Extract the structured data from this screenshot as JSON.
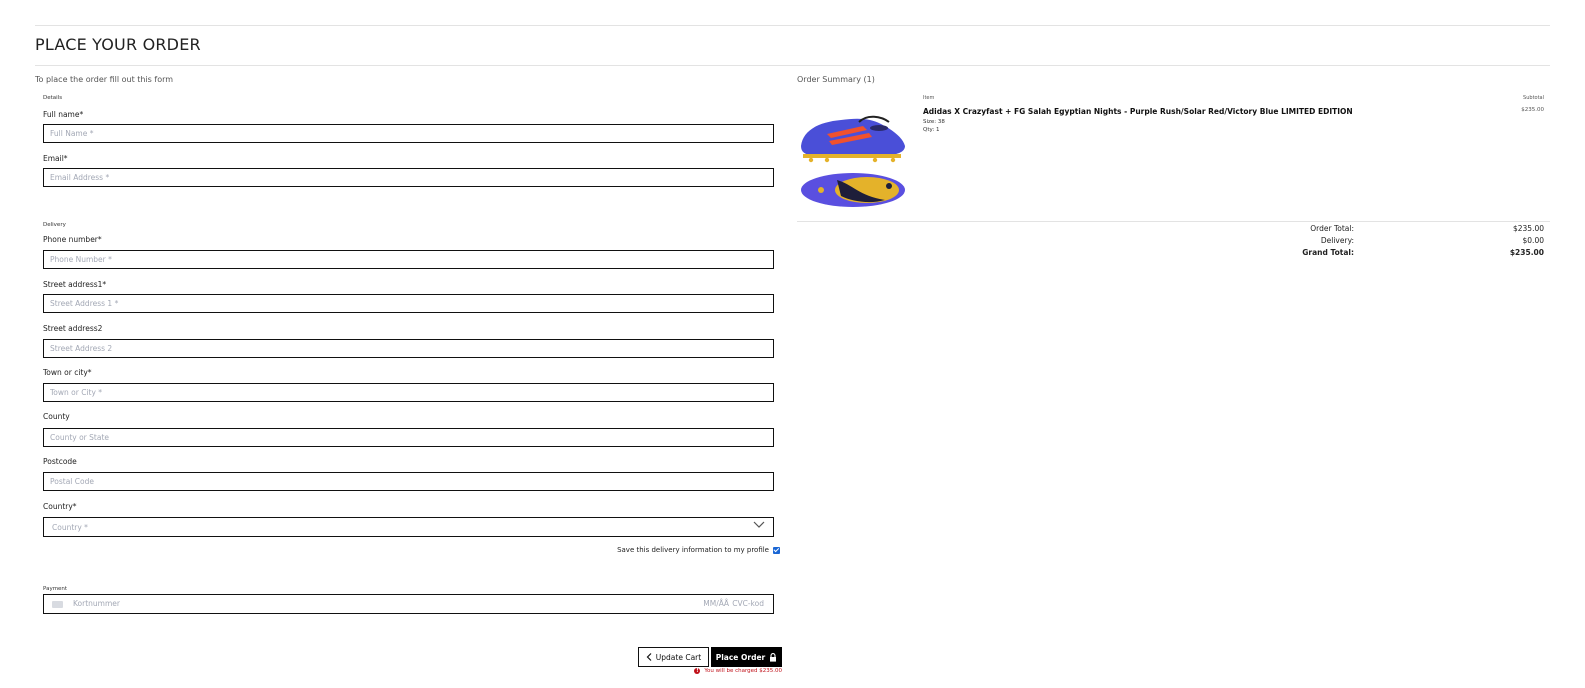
{
  "page": {
    "title": "PLACE YOUR ORDER",
    "intro": "To place the order fill out this form"
  },
  "form": {
    "details_legend": "Details",
    "full_name": {
      "label": "Full name*",
      "placeholder": "Full Name *"
    },
    "email": {
      "label": "Email*",
      "placeholder": "Email Address *"
    },
    "delivery_legend": "Delivery",
    "phone": {
      "label": "Phone number*",
      "placeholder": "Phone Number *"
    },
    "street1": {
      "label": "Street address1*",
      "placeholder": "Street Address 1 *"
    },
    "street2": {
      "label": "Street address2",
      "placeholder": "Street Address 2"
    },
    "town": {
      "label": "Town or city*",
      "placeholder": "Town or City *"
    },
    "county": {
      "label": "County",
      "placeholder": "County or State"
    },
    "postcode": {
      "label": "Postcode",
      "placeholder": "Postal Code"
    },
    "country": {
      "label": "Country*",
      "placeholder": "Country *"
    },
    "save_info": "Save this delivery information to my profile",
    "save_info_checked": true,
    "payment_legend": "Payment",
    "card": {
      "number_placeholder": "Kortnummer",
      "expiry_placeholder": "MM/ÅÅ",
      "cvc_placeholder": "CVC-kod",
      "icon": "credit-card-icon"
    }
  },
  "actions": {
    "update_cart": "Update Cart",
    "place_order": "Place Order",
    "charge_notice": "You will be charged $235.00",
    "update_icon": "chevron-left-icon",
    "place_icon": "lock-icon",
    "notice_icon": "exclamation-circle-icon"
  },
  "summary": {
    "title": "Order Summary (1)",
    "item_header": "Item",
    "subtotal_header": "Subtotal",
    "item": {
      "name": "Adidas X Crazyfast + FG Salah Egyptian Nights - Purple Rush/Solar Red/Victory Blue LIMITED EDITION",
      "size": "Size: 38",
      "qty": "Qty: 1",
      "subtotal": "$235.00",
      "colors": {
        "upper": "#4a4fd8",
        "stripes": "#f0512e",
        "sole": "#e4b22a"
      }
    },
    "totals": [
      {
        "label": "Order Total:",
        "value": "$235.00"
      },
      {
        "label": "Delivery:",
        "value": "$0.00"
      },
      {
        "label": "Grand Total:",
        "value": "$235.00"
      }
    ]
  },
  "colors": {
    "accent": "#000000",
    "error": "#c0111a",
    "checkbox": "#1a66d4"
  }
}
